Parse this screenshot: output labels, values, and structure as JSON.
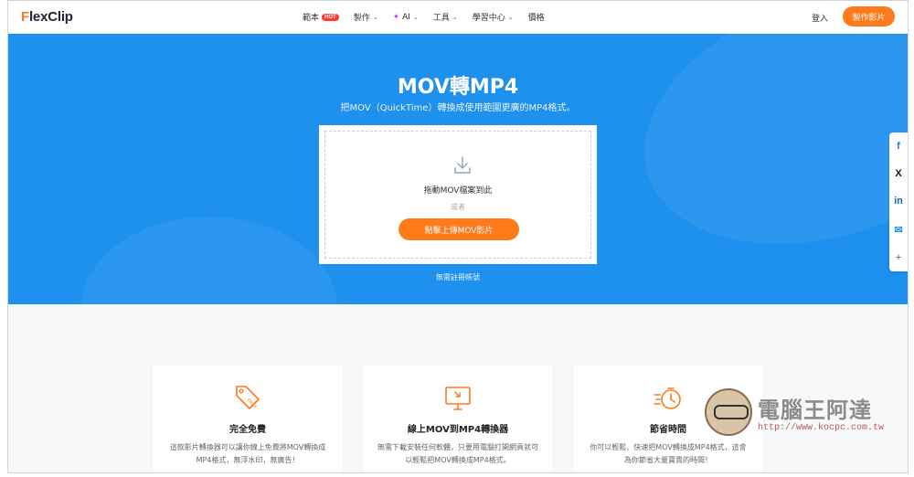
{
  "nav": {
    "logo_prefix": "F",
    "logo_rest": "lexClip",
    "items": [
      {
        "label": "範本",
        "badge": "HOT"
      },
      {
        "label": "製作",
        "caret": "⌄"
      },
      {
        "label": "AI",
        "caret": "⌄"
      },
      {
        "label": "工具",
        "caret": "⌄"
      },
      {
        "label": "學習中心",
        "caret": "⌄"
      },
      {
        "label": "價格"
      }
    ],
    "login": "登入",
    "cta": "製作影片"
  },
  "hero": {
    "title": "MOV轉MP4",
    "subtitle": "把MOV（QuickTime）轉換成使用範圍更廣的MP4格式。",
    "drop_text": "拖動MOV檔案到此",
    "or_text": "或者",
    "upload_button": "點擊上傳MOV影片",
    "no_register": "無需註冊帳號"
  },
  "social": [
    "f",
    "X",
    "in",
    "✉",
    "+"
  ],
  "features": [
    {
      "title": "完全免費",
      "desc": "這款影片轉換器可以讓你線上免費將MOV轉換成MP4格式，無浮水印，無廣告！",
      "icon": "free-tag-icon"
    },
    {
      "title": "線上MOV到MP4轉換器",
      "desc": "無需下載安裝任何軟體，只要用電腦打開網頁就可以輕鬆把MOV轉換成MP4格式。",
      "icon": "monitor-icon"
    },
    {
      "title": "節省時間",
      "desc": "你可以輕鬆、快速把MOV轉換成MP4格式，這會為你節省大量寶貴的時間！",
      "icon": "stopwatch-icon"
    }
  ],
  "watermark": {
    "text": "電腦王阿達",
    "url": "http://www.kocpc.com.tw"
  },
  "colors": {
    "accent": "#ff7a1a",
    "hero_bg": "#1e90ee",
    "hot_badge": "#ff3b30"
  }
}
